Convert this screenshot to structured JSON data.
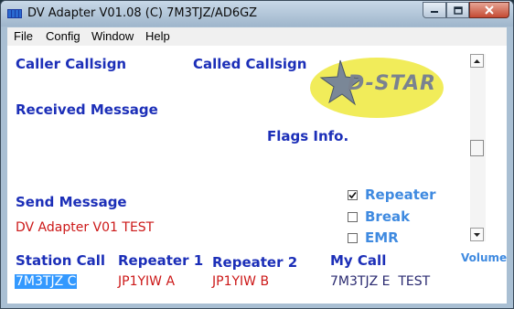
{
  "window": {
    "title": "DV Adapter V01.08 (C) 7M3TJZ/AD6GZ"
  },
  "menu": {
    "file": "File",
    "config": "Config",
    "window": "Window",
    "help": "Help"
  },
  "labels": {
    "caller_callsign": "Caller Callsign",
    "called_callsign": "Called Callsign",
    "received_message": "Received Message",
    "flags_info": "Flags Info.",
    "send_message": "Send Message",
    "station_call": "Station Call",
    "repeater1": "Repeater 1",
    "repeater2": "Repeater 2",
    "my_call": "My Call",
    "volume": "Volume"
  },
  "values": {
    "send_message": "DV Adapter V01 TEST",
    "station_call": "7M3TJZ C",
    "repeater1": "JP1YIW A",
    "repeater2": "JP1YIW B",
    "my_call": "7M3TJZ E  TEST"
  },
  "logo": {
    "text": "D-STAR"
  },
  "checkboxes": [
    {
      "label": "Repeater",
      "checked": true
    },
    {
      "label": "Break",
      "checked": false
    },
    {
      "label": "EMR",
      "checked": false
    }
  ],
  "colors": {
    "label_blue": "#1c2fb8",
    "value_red": "#cc1818",
    "checkbox_blue": "#3f8ae0",
    "logo_yellow": "#f1ec5a"
  }
}
